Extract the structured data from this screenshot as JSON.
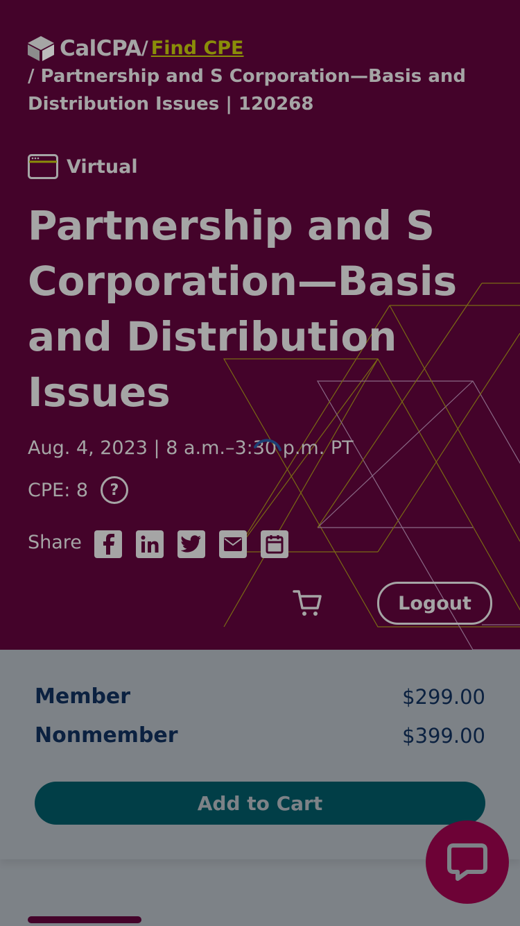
{
  "header": {
    "logo_text": "CalCPA",
    "separator": "/",
    "find_cpe_link": "Find CPE",
    "breadcrumb_rest": "/ Partnership and S Corporation—Basis and Distribution Issues | 120268"
  },
  "event": {
    "format_label": "Virtual",
    "title": "Partnership and S Corporation—Basis and Distribution Issues",
    "date_time": "Aug. 4, 2023 | 8 a.m.–3:30 p.m. PT",
    "cpe": "CPE: 8",
    "help_icon": "?"
  },
  "share": {
    "label": "Share",
    "icons": [
      "facebook-icon",
      "linkedin-icon",
      "twitter-icon",
      "email-icon",
      "calendar-icon"
    ]
  },
  "account": {
    "logout_label": "Logout",
    "cart_icon": "cart-icon"
  },
  "pricing": {
    "member_label": "Member",
    "member_price": "$299.00",
    "nonmember_label": "Nonmember",
    "nonmember_price": "$399.00",
    "add_to_cart_label": "Add to Cart"
  },
  "colors": {
    "hero_bg": "#44032a",
    "link": "#8a8d09",
    "price_text": "#0b2140",
    "button_bg": "#013e47",
    "chat_bg": "#6d0236"
  }
}
